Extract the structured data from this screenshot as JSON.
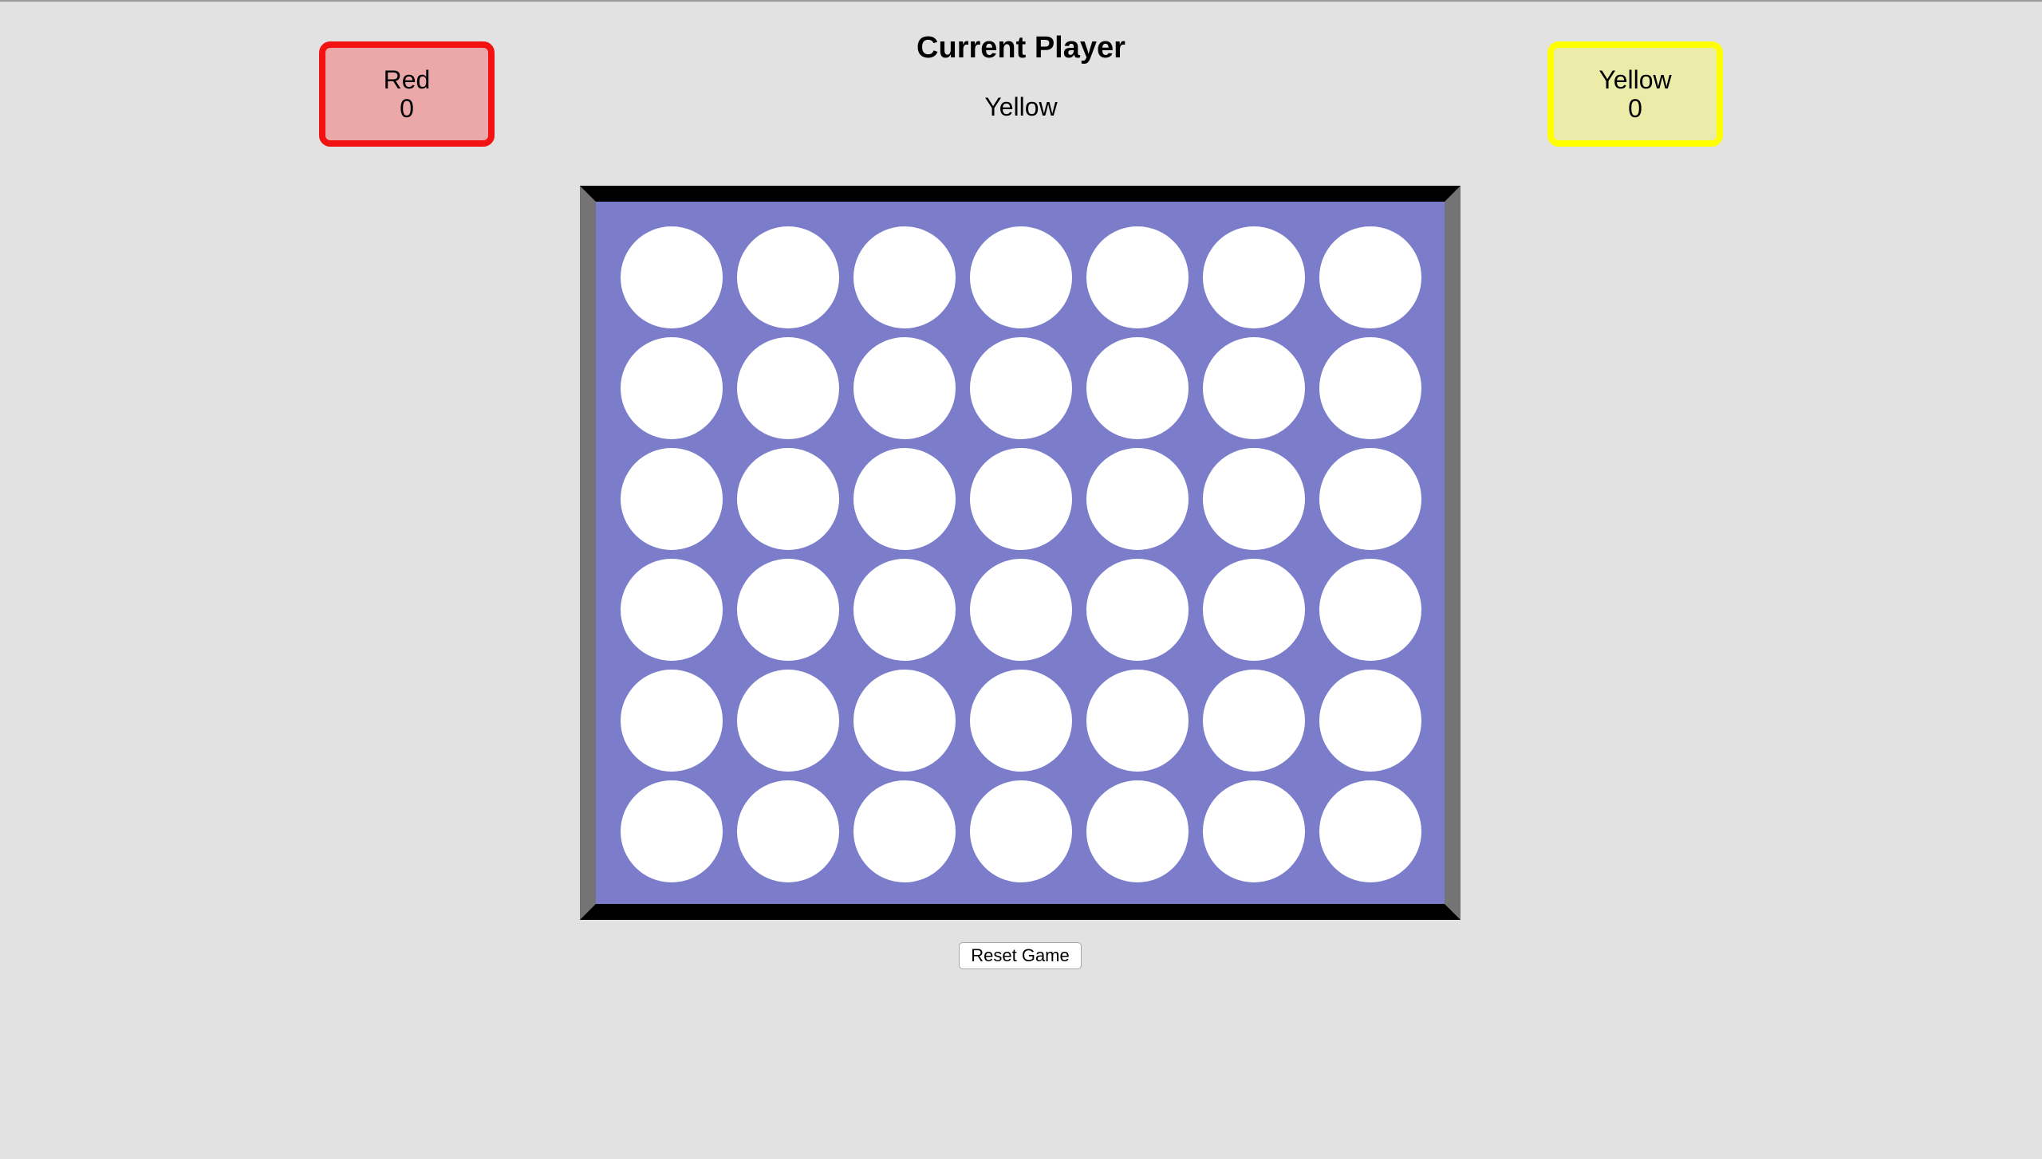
{
  "players": {
    "red": {
      "name": "Red",
      "score": "0",
      "color": "#f21212"
    },
    "yellow": {
      "name": "Yellow",
      "score": "0",
      "color": "#ffff00"
    }
  },
  "status": {
    "title": "Current Player",
    "current": "Yellow"
  },
  "board": {
    "rows": 6,
    "columns": 7,
    "board_color": "#7b7dcb",
    "cells": [
      [
        "empty",
        "empty",
        "empty",
        "empty",
        "empty",
        "empty",
        "empty"
      ],
      [
        "empty",
        "empty",
        "empty",
        "empty",
        "empty",
        "empty",
        "empty"
      ],
      [
        "empty",
        "empty",
        "empty",
        "empty",
        "empty",
        "empty",
        "empty"
      ],
      [
        "empty",
        "empty",
        "empty",
        "empty",
        "empty",
        "empty",
        "empty"
      ],
      [
        "empty",
        "empty",
        "empty",
        "empty",
        "empty",
        "empty",
        "empty"
      ],
      [
        "empty",
        "empty",
        "empty",
        "empty",
        "empty",
        "empty",
        "empty"
      ]
    ]
  },
  "controls": {
    "reset_label": "Reset Game"
  }
}
